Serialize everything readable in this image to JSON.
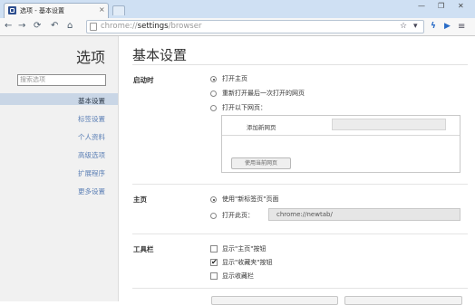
{
  "tab": {
    "title": "选项 - 基本设置",
    "close": "×"
  },
  "window": {
    "minimize": "—",
    "restore": "❐",
    "close": "✕"
  },
  "nav": {
    "back": "←",
    "forward": "→",
    "reload": "⟳",
    "undo": "↶",
    "home": "⌂"
  },
  "omnibox": {
    "url_prefix": "chrome://",
    "url_host": "settings",
    "url_path": "/browser"
  },
  "toolbar_icons": {
    "star": "☆",
    "dropdown": "▾",
    "bolt": "ϟ",
    "play": "▶",
    "menu": "≡",
    "wrench": "🔧"
  },
  "sidebar": {
    "title": "选项",
    "search_placeholder": "搜索选项",
    "items": [
      {
        "label": "基本设置",
        "active": true
      },
      {
        "label": "标签设置"
      },
      {
        "label": "个人资料"
      },
      {
        "label": "高级选项"
      },
      {
        "label": "扩展程序"
      },
      {
        "label": "更多设置"
      }
    ]
  },
  "main": {
    "title": "基本设置",
    "startup": {
      "heading": "启动时",
      "options": [
        "打开主页",
        "重新打开最后一次打开的网页",
        "打开以下网页："
      ],
      "selected": 0,
      "add_page_label": "添加新网页",
      "use_current_button": "使用当前网页"
    },
    "homepage": {
      "heading": "主页",
      "options": [
        "使用\"新标签页\"页面",
        "打开此页："
      ],
      "selected": 0,
      "url": "chrome://newtab/"
    },
    "toolbar": {
      "heading": "工具栏",
      "options": [
        {
          "label": "显示\"主页\"按钮",
          "checked": false
        },
        {
          "label": "显示\"收藏夹\"按钮",
          "checked": true
        },
        {
          "label": "显示收藏栏",
          "checked": false
        }
      ]
    }
  }
}
